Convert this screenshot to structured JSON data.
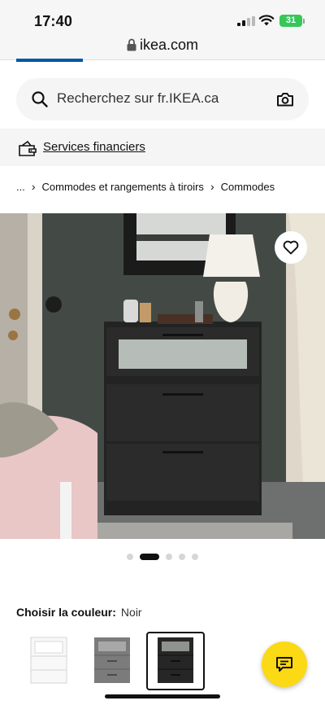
{
  "status_bar": {
    "time": "17:40",
    "battery": "31"
  },
  "browser": {
    "url": "ikea.com"
  },
  "search": {
    "placeholder": "Recherchez sur fr.IKEA.ca"
  },
  "financial": {
    "label": "Services financiers"
  },
  "breadcrumb": [
    "...",
    "Commodes et rangements à tiroirs",
    "Commodes"
  ],
  "carousel": {
    "total": 5,
    "active_index": 1
  },
  "color": {
    "label": "Choisir la couleur:",
    "selected": "Noir"
  },
  "swatches": [
    {
      "name": "white",
      "color": "#f4f4f4",
      "selected": false
    },
    {
      "name": "gray",
      "color": "#7d7d7d",
      "selected": false
    },
    {
      "name": "black",
      "color": "#2b2b2b",
      "selected": true
    }
  ],
  "colors": {
    "ikea_blue": "#0058a3",
    "chat_yellow": "#fbd914",
    "battery_green": "#36c759"
  }
}
